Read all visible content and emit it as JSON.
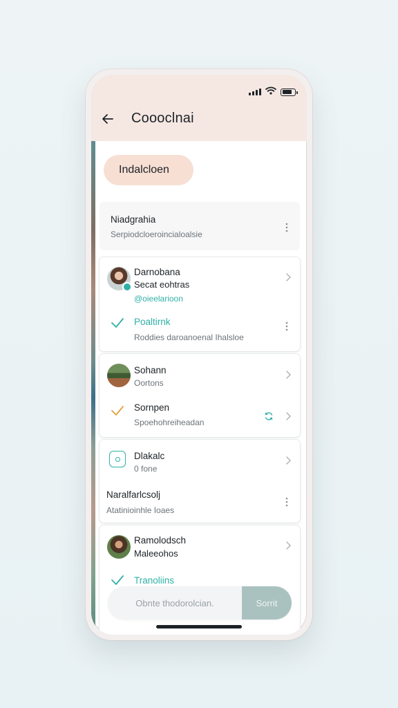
{
  "header": {
    "title": "Coooclnai",
    "back_icon": "arrow-left-icon"
  },
  "status_bar": {
    "icons": [
      "signal-icon",
      "wifi-icon",
      "battery-icon"
    ]
  },
  "chip": {
    "label": "Indalcloen"
  },
  "section": {
    "title": "Niadgrahia",
    "subtitle": "Serpiodcloeroincialoalsie"
  },
  "group1": {
    "contact": {
      "name": "Darnobana",
      "detail": "Secat eohtras",
      "handle": "@oieelarioon"
    },
    "item": {
      "title": "Poaltirnk",
      "subtitle": "Roddies daroanoenal Ihalsloe"
    }
  },
  "group2": {
    "contact": {
      "name": "Sohann",
      "detail": "Oortons"
    },
    "item": {
      "title": "Sornpen",
      "subtitle": "Spoehohreiheadan"
    }
  },
  "group3": {
    "contact": {
      "name": "Dlakalc",
      "detail": "0 fone"
    },
    "item": {
      "title": "Naralfarlcsolj",
      "subtitle": "Atatinioinhle Ioaes"
    }
  },
  "group4": {
    "contact": {
      "name": "Ramolodsch",
      "detail": "Maleeohos"
    },
    "item": {
      "title": "Tranoliins"
    }
  },
  "bottom": {
    "placeholder": "Obnte thodorolcian.",
    "button_label": "Sorrit"
  },
  "colors": {
    "accent_teal": "#2fb0a7",
    "check_orange": "#e0a23a",
    "header_bg": "#f5e8e3",
    "chip_bg": "#f7dfd4",
    "button_bg": "#a9c2c0"
  }
}
